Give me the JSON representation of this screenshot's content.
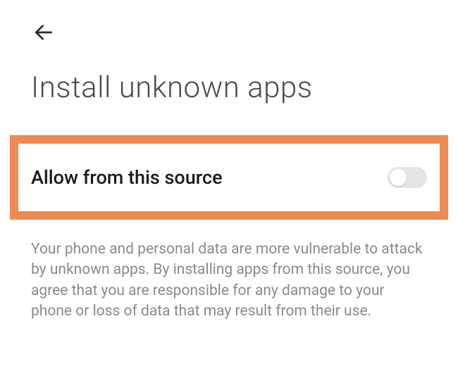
{
  "header": {
    "title": "Install unknown apps"
  },
  "setting": {
    "label": "Allow from this source",
    "enabled": false,
    "highlight_color": "#ee8a52"
  },
  "description": "Your phone and personal data are more vulnerable to attack by unknown apps. By installing apps from this source, you agree that you are responsible for any damage to your phone or loss of data that may result from their use."
}
